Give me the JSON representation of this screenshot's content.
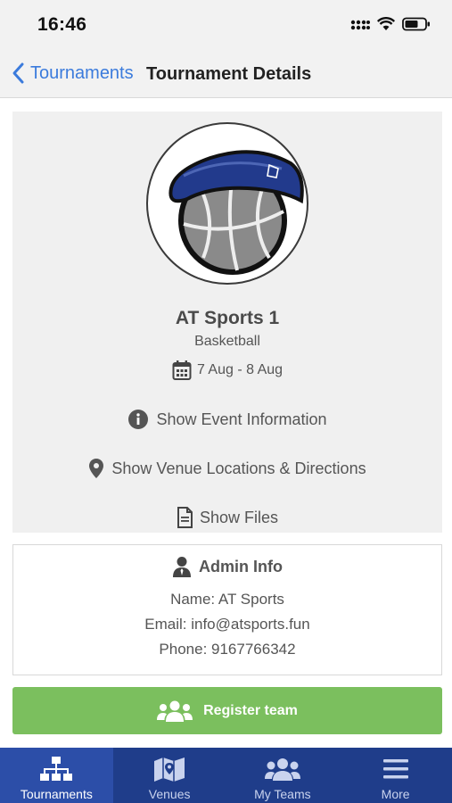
{
  "status_bar": {
    "time": "16:46"
  },
  "nav": {
    "back_label": "Tournaments",
    "title": "Tournament Details"
  },
  "event": {
    "name": "AT Sports 1",
    "sport": "Basketball",
    "dates": "7 Aug - 8 Aug",
    "links": {
      "info": "Show Event Information",
      "venue": "Show Venue Locations & Directions",
      "files": "Show Files"
    }
  },
  "admin": {
    "heading": "Admin Info",
    "name": "Name: AT Sports",
    "email": "Email: info@atsports.fun",
    "phone": "Phone: 9167766342"
  },
  "register": {
    "label": "Register team"
  },
  "tabs": [
    {
      "label": "Tournaments",
      "icon": "org-chart-icon",
      "active": true
    },
    {
      "label": "Venues",
      "icon": "map-icon",
      "active": false
    },
    {
      "label": "My Teams",
      "icon": "users-icon",
      "active": false
    },
    {
      "label": "More",
      "icon": "menu-icon",
      "active": false
    }
  ],
  "colors": {
    "accent": "#3b7bdc",
    "tab_bar": "#1f3d8a",
    "tab_active": "#2c4ea8",
    "register": "#7bbf5e",
    "card": "#f0f0f0"
  }
}
